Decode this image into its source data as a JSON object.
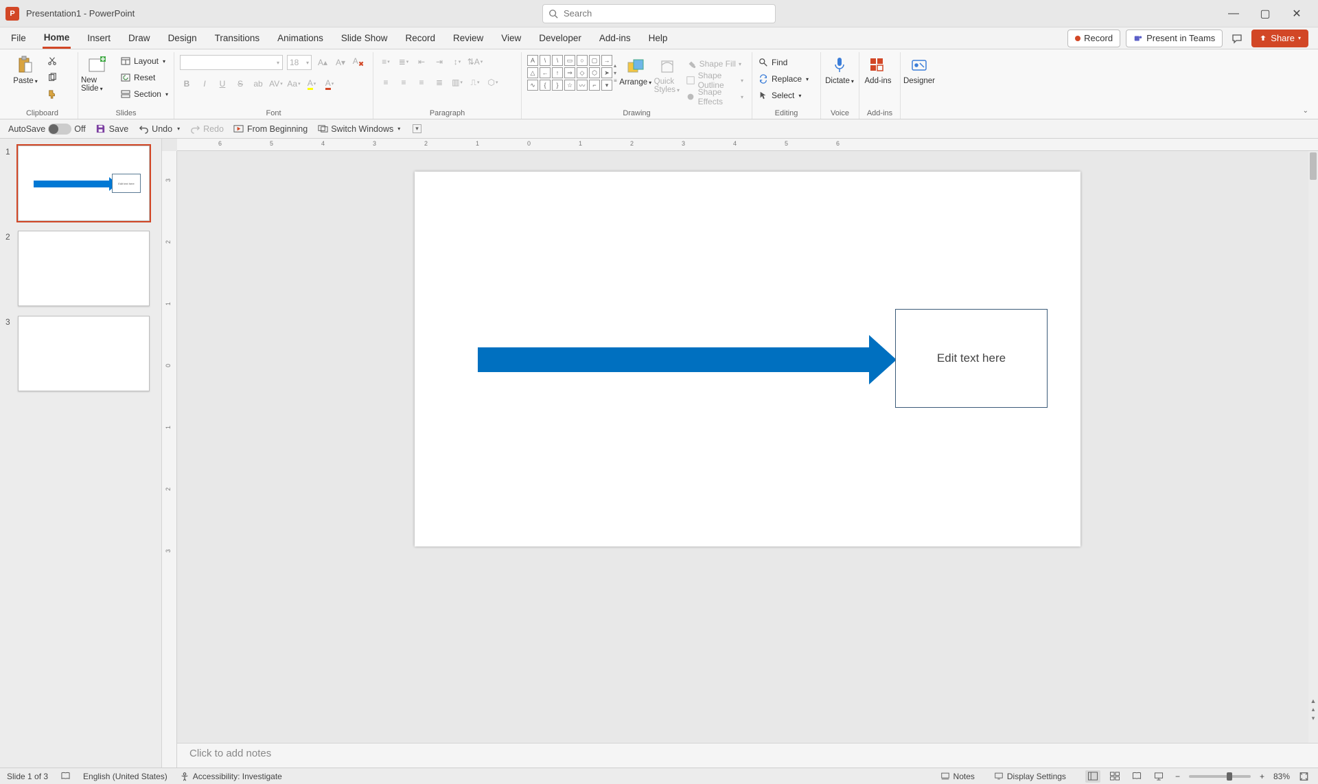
{
  "title": {
    "doc": "Presentation1",
    "sep": "  -  ",
    "app": "PowerPoint"
  },
  "search": {
    "placeholder": "Search"
  },
  "window_controls": {
    "minimize": "—",
    "maximize": "▢",
    "close": "✕"
  },
  "tabs": {
    "file": "File",
    "home": "Home",
    "insert": "Insert",
    "draw": "Draw",
    "design": "Design",
    "transitions": "Transitions",
    "animations": "Animations",
    "slideshow": "Slide Show",
    "record": "Record",
    "review": "Review",
    "view": "View",
    "developer": "Developer",
    "addins": "Add-ins",
    "help": "Help"
  },
  "right_tabs": {
    "record": "Record",
    "present_teams": "Present in Teams",
    "share": "Share"
  },
  "ribbon": {
    "clipboard": {
      "paste": "Paste",
      "group": "Clipboard"
    },
    "slides": {
      "new_slide": "New Slide",
      "layout": "Layout",
      "reset": "Reset",
      "section": "Section",
      "group": "Slides"
    },
    "font": {
      "size": "18",
      "group": "Font"
    },
    "paragraph": {
      "group": "Paragraph"
    },
    "drawing": {
      "arrange": "Arrange",
      "quick_styles": "Quick Styles",
      "shape_fill": "Shape Fill",
      "shape_outline": "Shape Outline",
      "shape_effects": "Shape Effects",
      "group": "Drawing"
    },
    "editing": {
      "find": "Find",
      "replace": "Replace",
      "select": "Select",
      "group": "Editing"
    },
    "voice": {
      "dictate": "Dictate",
      "group": "Voice"
    },
    "addins": {
      "label": "Add-ins",
      "group": "Add-ins"
    },
    "designer": {
      "label": "Designer"
    }
  },
  "qat": {
    "autosave": "AutoSave",
    "off": "Off",
    "save": "Save",
    "undo": "Undo",
    "redo": "Redo",
    "from_beginning": "From Beginning",
    "switch_windows": "Switch Windows"
  },
  "thumbnails": [
    "1",
    "2",
    "3"
  ],
  "thumb1_box_text": "Edit text here",
  "slide_content": {
    "textbox": "Edit text here"
  },
  "ruler_h": [
    "6",
    "5",
    "4",
    "3",
    "2",
    "1",
    "0",
    "1",
    "2",
    "3",
    "4",
    "5",
    "6"
  ],
  "ruler_v": [
    "3",
    "2",
    "1",
    "0",
    "1",
    "2",
    "3"
  ],
  "notes_placeholder": "Click to add notes",
  "status": {
    "slide": "Slide 1 of 3",
    "language": "English (United States)",
    "accessibility": "Accessibility: Investigate",
    "notes": "Notes",
    "display": "Display Settings",
    "zoom": "83%"
  }
}
